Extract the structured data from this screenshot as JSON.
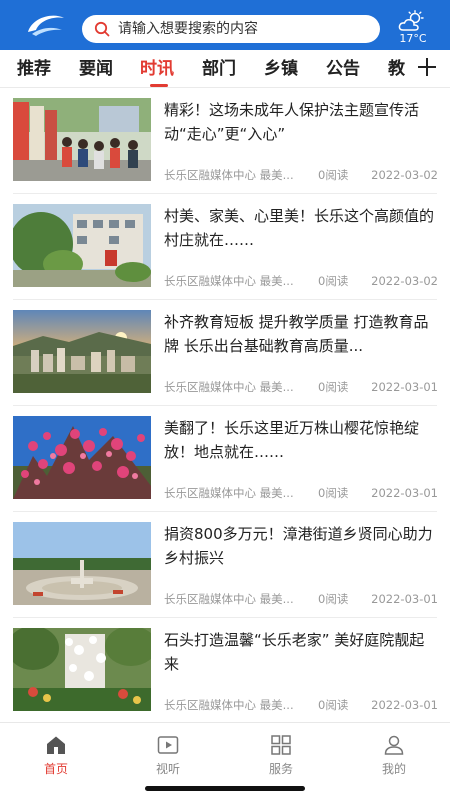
{
  "header": {
    "logo_icon": "swoosh-logo-icon",
    "search_placeholder": "请输入想要搜索的内容",
    "weather_icon": "partly-cloudy-icon",
    "temperature": "17°C"
  },
  "tabs": [
    {
      "label": "推荐",
      "active": false
    },
    {
      "label": "要闻",
      "active": false
    },
    {
      "label": "时讯",
      "active": true
    },
    {
      "label": "部门",
      "active": false
    },
    {
      "label": "乡镇",
      "active": false
    },
    {
      "label": "公告",
      "active": false
    },
    {
      "label": "教",
      "active": false
    }
  ],
  "add_tab_icon": "plus-icon",
  "articles": [
    {
      "title": "精彩！这场未成年人保护法主题宣传活动“走心”更“入心”",
      "source": "长乐区融媒体中心 最美...",
      "reads": "0阅读",
      "date": "2022-03-02"
    },
    {
      "title": "村美、家美、心里美！长乐这个高颜值的村庄就在……",
      "source": "长乐区融媒体中心 最美...",
      "reads": "0阅读",
      "date": "2022-03-02"
    },
    {
      "title": "补齐教育短板 提升教学质量 打造教育品牌 长乐出台基础教育高质量...",
      "source": "长乐区融媒体中心 最美...",
      "reads": "0阅读",
      "date": "2022-03-01"
    },
    {
      "title": "美翻了！长乐这里近万株山樱花惊艳绽放！地点就在……",
      "source": "长乐区融媒体中心 最美...",
      "reads": "0阅读",
      "date": "2022-03-01"
    },
    {
      "title": "捐资800多万元！漳港街道乡贤同心助力乡村振兴",
      "source": "长乐区融媒体中心 最美...",
      "reads": "0阅读",
      "date": "2022-03-01"
    },
    {
      "title": "石头打造温馨“长乐老家” 美好庭院靓起来",
      "source": "长乐区融媒体中心 最美...",
      "reads": "0阅读",
      "date": "2022-03-01"
    }
  ],
  "bottom_nav": [
    {
      "label": "首页",
      "icon": "home-icon",
      "active": true
    },
    {
      "label": "视听",
      "icon": "video-icon",
      "active": false
    },
    {
      "label": "服务",
      "icon": "grid-icon",
      "active": false
    },
    {
      "label": "我的",
      "icon": "user-icon",
      "active": false
    }
  ],
  "colors": {
    "brand_blue": "#1f6fd6",
    "active_red": "#e23b32",
    "meta_gray": "#999999"
  }
}
